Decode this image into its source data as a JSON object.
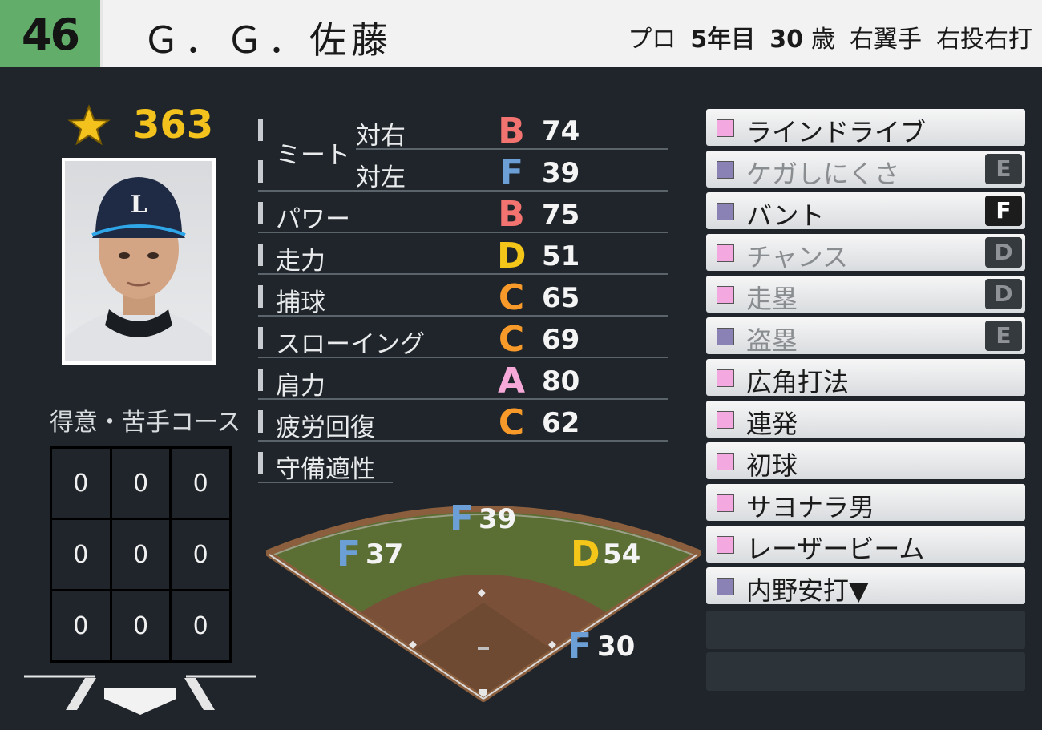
{
  "header": {
    "number": "46",
    "name": "Ｇ．Ｇ．佐藤",
    "info": [
      "プロ",
      "5年目",
      "30",
      "歳",
      "右翼手",
      "右投右打"
    ]
  },
  "overall": "363",
  "course": {
    "title": "得意・苦手コース",
    "cells": [
      "0",
      "0",
      "0",
      "0",
      "0",
      "0",
      "0",
      "0",
      "0"
    ]
  },
  "meet_group": "ミート",
  "stats": [
    {
      "label": "対右",
      "grade": "B",
      "value": "74",
      "color": "#f2736f"
    },
    {
      "label": "対左",
      "grade": "F",
      "value": "39",
      "color": "#6b9fd6"
    },
    {
      "label": "パワー",
      "grade": "B",
      "value": "75",
      "color": "#f2736f"
    },
    {
      "label": "走力",
      "grade": "D",
      "value": "51",
      "color": "#f4c61a"
    },
    {
      "label": "捕球",
      "grade": "C",
      "value": "65",
      "color": "#f79a2a"
    },
    {
      "label": "スローイング",
      "grade": "C",
      "value": "69",
      "color": "#f79a2a"
    },
    {
      "label": "肩力",
      "grade": "A",
      "value": "80",
      "color": "#f6a8d8"
    },
    {
      "label": "疲労回復",
      "grade": "C",
      "value": "62",
      "color": "#f79a2a"
    }
  ],
  "defense_label": "守備適性",
  "positions": [
    {
      "grade": "F",
      "value": "39",
      "color": "#6b9fd6"
    },
    {
      "grade": "F",
      "value": "37",
      "color": "#6b9fd6"
    },
    {
      "grade": "D",
      "value": "54",
      "color": "#f4c61a"
    },
    {
      "grade": "F",
      "value": "30",
      "color": "#6b9fd6"
    }
  ],
  "skills": [
    {
      "label": "ラインドライブ",
      "box": "#f4a8e0",
      "dim": false,
      "badge": ""
    },
    {
      "label": "ケガしにくさ",
      "box": "#8a82b4",
      "dim": true,
      "badge": "E"
    },
    {
      "label": "バント",
      "box": "#8a82b4",
      "dim": false,
      "badge": "F"
    },
    {
      "label": "チャンス",
      "box": "#f4a8e0",
      "dim": true,
      "badge": "D"
    },
    {
      "label": "走塁",
      "box": "#f4a8e0",
      "dim": true,
      "badge": "D"
    },
    {
      "label": "盗塁",
      "box": "#8a82b4",
      "dim": true,
      "badge": "E"
    },
    {
      "label": "広角打法",
      "box": "#f4a8e0",
      "dim": false,
      "badge": ""
    },
    {
      "label": "連発",
      "box": "#f4a8e0",
      "dim": false,
      "badge": ""
    },
    {
      "label": "初球",
      "box": "#f4a8e0",
      "dim": false,
      "badge": ""
    },
    {
      "label": "サヨナラ男",
      "box": "#f4a8e0",
      "dim": false,
      "badge": ""
    },
    {
      "label": "レーザービーム",
      "box": "#f4a8e0",
      "dim": false,
      "badge": ""
    },
    {
      "label": "内野安打▼",
      "box": "#8a82b4",
      "dim": false,
      "badge": ""
    }
  ]
}
